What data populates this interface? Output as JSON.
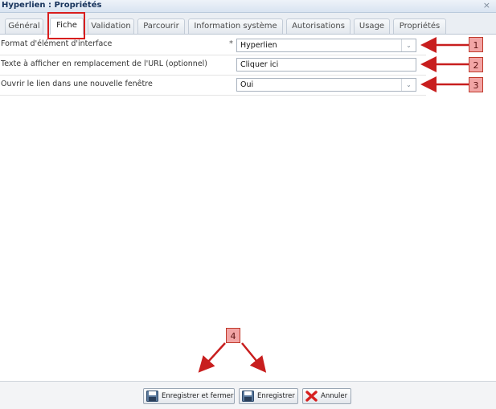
{
  "window": {
    "title": "Hyperlien : Propriétés",
    "close_glyph": "×"
  },
  "tabs": [
    {
      "label": "Général"
    },
    {
      "label": "Fiche"
    },
    {
      "label": "Validation"
    },
    {
      "label": "Parcourir"
    },
    {
      "label": "Information système"
    },
    {
      "label": "Autorisations"
    },
    {
      "label": "Usage"
    },
    {
      "label": "Propriétés"
    }
  ],
  "active_tab": "Fiche",
  "form": {
    "rows": [
      {
        "label": "Format d'élément d'interface",
        "required_mark": "*",
        "value": "Hyperlien",
        "type": "select"
      },
      {
        "label": "Texte à afficher en remplacement de l'URL (optionnel)",
        "value": "Cliquer ici",
        "type": "text"
      },
      {
        "label": "Ouvrir le lien dans une nouvelle fenêtre",
        "value": "Oui",
        "type": "select"
      }
    ]
  },
  "callouts": [
    "1",
    "2",
    "3",
    "4"
  ],
  "footer": {
    "save_close_label": "Enregistrer et fermer",
    "save_label": "Enregistrer",
    "cancel_label": "Annuler"
  },
  "colors": {
    "annotation_red": "#c81e1e",
    "callout_fill": "#f2a5a5"
  },
  "icons": [
    "close-icon",
    "dropdown-chevron-icon",
    "save-disk-icon",
    "cancel-x-icon"
  ]
}
